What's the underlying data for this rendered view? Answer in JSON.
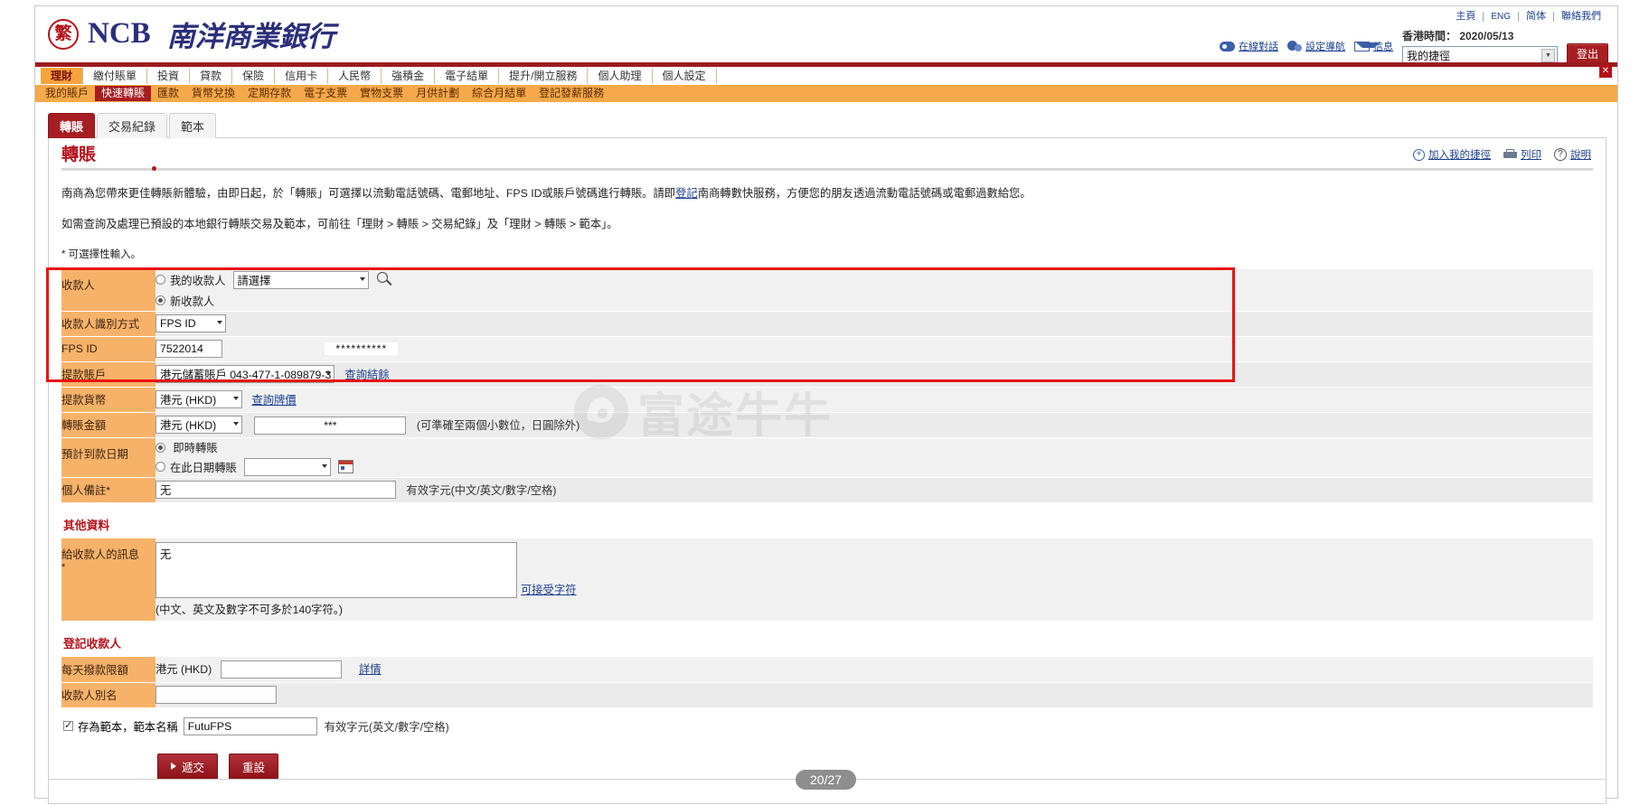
{
  "brand": {
    "seal_glyph": "繁",
    "name_en": "NCB",
    "name_zh": "南洋商業銀行"
  },
  "header": {
    "top_links": [
      {
        "label": "主頁",
        "name": "home"
      },
      {
        "label": "ENG",
        "name": "english"
      },
      {
        "label": "简体",
        "name": "simplified"
      },
      {
        "label": "聯絡我們",
        "name": "contact-us"
      }
    ],
    "tool_links": [
      {
        "label": "在線對話",
        "icon": "chat-icon",
        "name": "live-chat"
      },
      {
        "label": "設定導航",
        "icon": "gear-icon",
        "name": "settings-nav"
      },
      {
        "label": "信息",
        "icon": "mail-icon",
        "name": "messages"
      }
    ],
    "hk_time_label": "香港時間： 2020/05/13",
    "shortcut_value": "我的捷徑",
    "logout_label": "登出"
  },
  "nav": {
    "main": [
      {
        "label": "理財",
        "active": true
      },
      {
        "label": "繳付賬單",
        "active": false
      },
      {
        "label": "投資",
        "active": false
      },
      {
        "label": "貸款",
        "active": false
      },
      {
        "label": "保險",
        "active": false
      },
      {
        "label": "信用卡",
        "active": false
      },
      {
        "label": "人民幣",
        "active": false
      },
      {
        "label": "強積金",
        "active": false
      },
      {
        "label": "電子結單",
        "active": false
      },
      {
        "label": "提升/開立服務",
        "active": false
      },
      {
        "label": "個人助理",
        "active": false
      },
      {
        "label": "個人設定",
        "active": false
      }
    ],
    "sub": [
      {
        "label": "我的賬戶",
        "active": false
      },
      {
        "label": "快速轉賬",
        "active": true
      },
      {
        "label": "匯款",
        "active": false
      },
      {
        "label": "貨幣兌換",
        "active": false
      },
      {
        "label": "定期存款",
        "active": false
      },
      {
        "label": "電子支票",
        "active": false
      },
      {
        "label": "實物支票",
        "active": false
      },
      {
        "label": "月供計劃",
        "active": false
      },
      {
        "label": "綜合月結單",
        "active": false
      },
      {
        "label": "登記發薪服務",
        "active": false
      }
    ]
  },
  "tabs": [
    {
      "label": "轉賬",
      "active": true
    },
    {
      "label": "交易紀錄",
      "active": false
    },
    {
      "label": "範本",
      "active": false
    }
  ],
  "page": {
    "title": "轉賬",
    "head_links": [
      {
        "label": "加入我的捷徑",
        "icon": "plus-circle-icon",
        "name": "add-to-shortcut"
      },
      {
        "label": "列印",
        "icon": "print-icon",
        "name": "print"
      },
      {
        "label": "說明",
        "icon": "question-icon",
        "name": "help"
      }
    ],
    "desc_1_a": "南商為您帶來更佳轉賬新體驗，由即日起，於「轉賬」可選擇以流動電話號碼、電郵地址、FPS ID或賬戶號碼進行轉賬。請即",
    "desc_1_link": "登記",
    "desc_1_b": "南商轉數快服務，方便您的朋友透過流動電話號碼或電郵過數給您。",
    "desc_2": "如需查詢及處理已預設的本地銀行轉賬交易及範本，可前往「理財 > 轉賬 > 交易紀錄」及「理財 > 轉賬 > 範本」。",
    "desc_3": "* 可選擇性輸入。"
  },
  "form": {
    "payee": {
      "label": "收款人",
      "opt_existing_label": "我的收款人",
      "opt_existing_selected": false,
      "existing_select_value": "請選擇",
      "opt_new_label": "新收款人",
      "opt_new_selected": true
    },
    "payee_id_type": {
      "label": "收款人識別方式",
      "value": "FPS ID"
    },
    "fps_id": {
      "label": "FPS ID",
      "value": "7522014",
      "masked": "**********"
    },
    "debit_account": {
      "label": "提款賬戶",
      "value": "港元儲蓄賬戶 043-477-1-089879-3",
      "link": "查詢結餘"
    },
    "debit_currency": {
      "label": "提款貨幣",
      "value": "港元 (HKD)",
      "link": "查詢牌價"
    },
    "amount": {
      "label": "轉賬金額",
      "currency": "港元 (HKD)",
      "value": "***",
      "hint": "(可準確至兩個小數位，日圓除外)"
    },
    "value_date": {
      "label": "預計到款日期",
      "opt_now_label": "即時轉賬",
      "opt_now_selected": true,
      "opt_date_label": "在此日期轉賬",
      "opt_date_selected": false,
      "date_value": ""
    },
    "personal_remark": {
      "label": "個人備註*",
      "value": "无",
      "hint": "有效字元(中文/英文/數字/空格)"
    },
    "other_section": {
      "heading": "其他資料",
      "message_label": "給收款人的訊息",
      "message_label_mark": "*",
      "message_value": "无",
      "charset_link": "可接受字符",
      "message_note": "(中文、英文及數字不可多於140字符。)"
    },
    "register_section": {
      "heading": "登記收款人",
      "daily_limit_label": "每天撥款限額",
      "daily_limit_currency": "港元 (HKD)",
      "daily_limit_value": "",
      "daily_limit_link": "詳情",
      "alias_label": "收款人別名",
      "alias_value": ""
    },
    "save_template": {
      "checked": true,
      "label": "存為範本，範本名稱",
      "value": "FutuFPS",
      "hint": "有效字元(英文/數字/空格)"
    },
    "buttons": {
      "submit": "遞交",
      "reset": "重設"
    }
  },
  "watermark": {
    "text": "富途牛牛"
  },
  "page_badge": {
    "label": "20/27"
  },
  "colors": {
    "brand_red": "#a61e22",
    "nav_orange": "#f6a94a",
    "label_orange": "#f7b26a",
    "link_blue": "#1b3f8f",
    "annotation_red": "#e8140f"
  }
}
